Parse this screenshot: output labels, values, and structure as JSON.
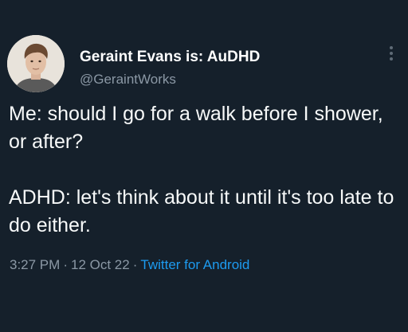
{
  "colors": {
    "background": "#15202b",
    "primary_text": "#ffffff",
    "secondary_text": "#8b98a5",
    "link": "#1d9bf0"
  },
  "author": {
    "display_name": "Geraint Evans is: AuDHD",
    "handle": "@GeraintWorks",
    "avatar_icon": "user-photo"
  },
  "menu": {
    "icon": "more-vertical-icon"
  },
  "tweet": {
    "paragraph_1": "Me: should I go for a walk before I shower, or after?",
    "paragraph_2": "ADHD: let's think about it until it's too late to do either."
  },
  "meta": {
    "time": "3:27 PM",
    "separator": "·",
    "date": "12 Oct 22",
    "source": "Twitter for Android"
  }
}
